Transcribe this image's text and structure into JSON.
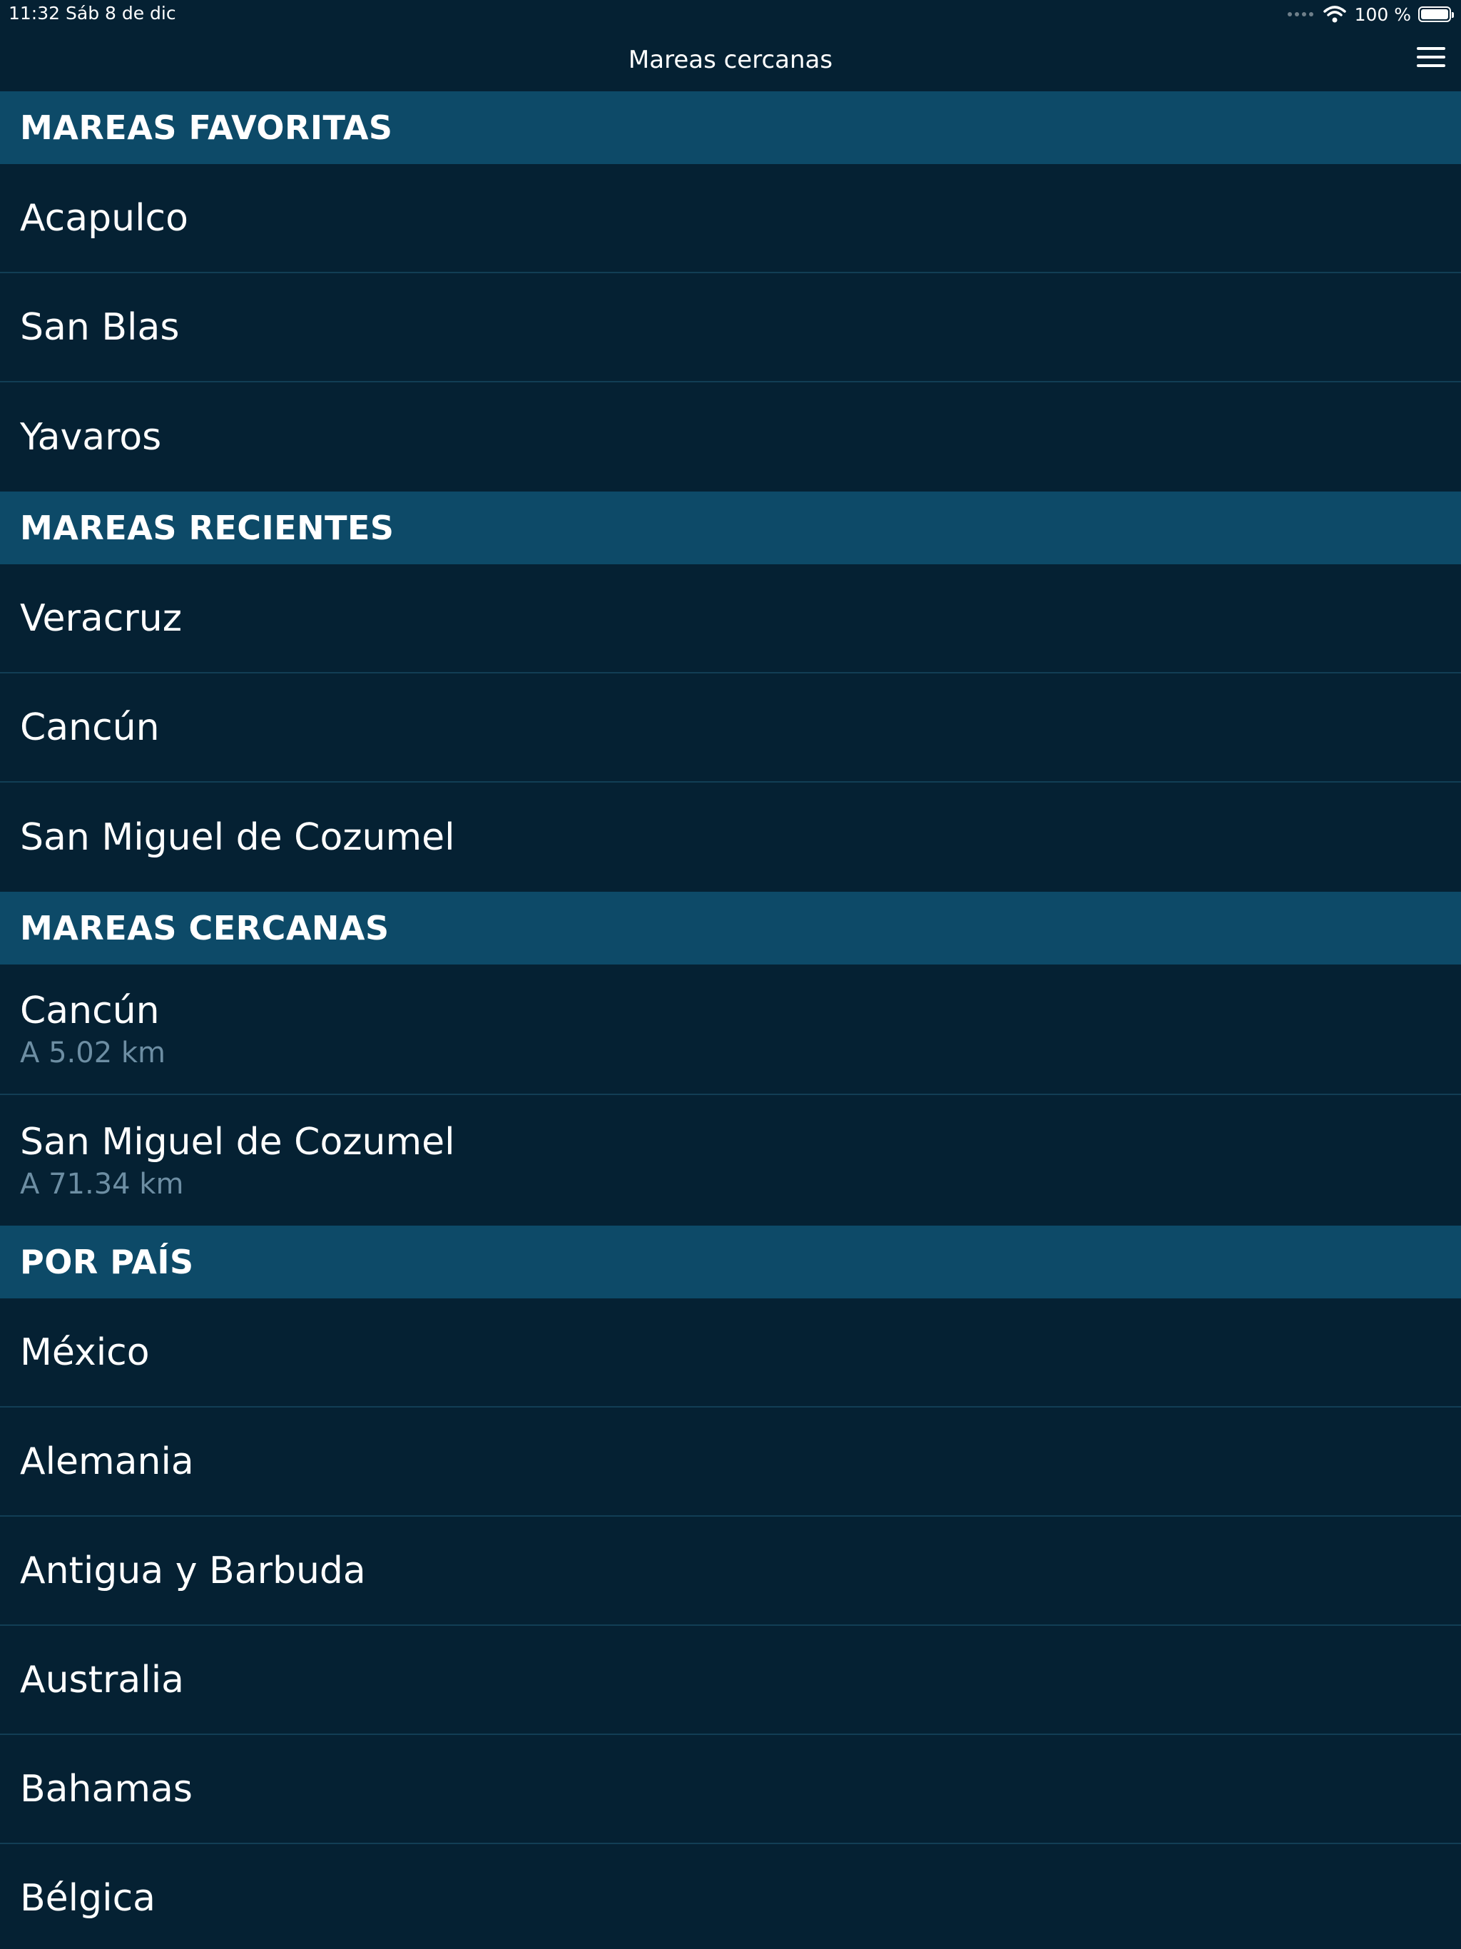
{
  "status_bar": {
    "time": "11:32",
    "date": "Sáb 8 de dic",
    "battery_percent": "100 %",
    "battery_level": 1.0,
    "icons": [
      "signal-dots-icon",
      "wifi-icon",
      "battery-icon"
    ]
  },
  "nav_bar": {
    "title": "Mareas cercanas",
    "menu_icon": "hamburger-menu-icon"
  },
  "sections": {
    "favorites": {
      "header": "MAREAS FAVORITAS",
      "items": [
        {
          "name": "Acapulco"
        },
        {
          "name": "San Blas"
        },
        {
          "name": "Yavaros"
        }
      ]
    },
    "recent": {
      "header": "MAREAS RECIENTES",
      "items": [
        {
          "name": "Veracruz"
        },
        {
          "name": "Cancún"
        },
        {
          "name": "San Miguel de Cozumel"
        }
      ]
    },
    "nearby": {
      "header": "MAREAS CERCANAS",
      "items": [
        {
          "name": "Cancún",
          "distance": "A 5.02 km"
        },
        {
          "name": "San Miguel de Cozumel",
          "distance": "A 71.34 km"
        }
      ]
    },
    "by_country": {
      "header": "POR PAÍS",
      "items": [
        {
          "name": "México"
        },
        {
          "name": "Alemania"
        },
        {
          "name": "Antigua y Barbuda"
        },
        {
          "name": "Australia"
        },
        {
          "name": "Bahamas"
        },
        {
          "name": "Bélgica"
        }
      ]
    }
  },
  "colors": {
    "background": "#052133",
    "section_header": "#0d4a68",
    "separator": "#123e55",
    "subtitle_text": "#6d8ea3",
    "text": "#ffffff"
  }
}
